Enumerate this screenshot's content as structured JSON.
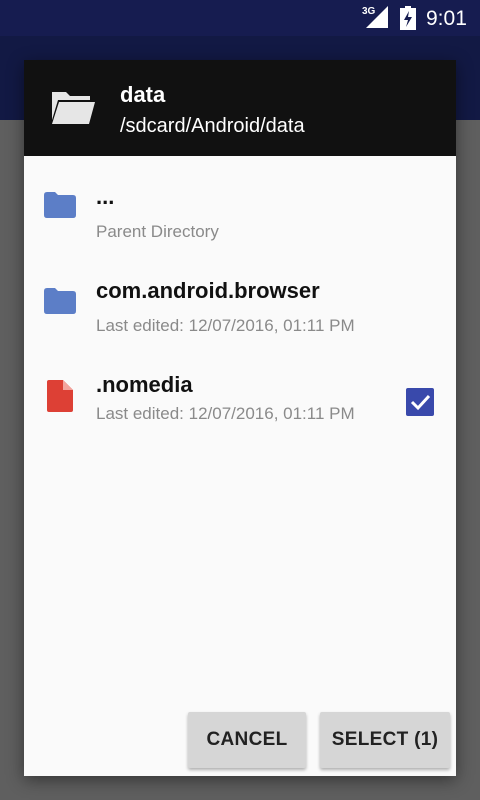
{
  "status_bar": {
    "network_label": "3G",
    "time": "9:01"
  },
  "dialog": {
    "header": {
      "icon": "folder-open-icon",
      "title": "data",
      "path": "/sdcard/Android/data"
    },
    "items": [
      {
        "icon": "folder-icon",
        "name": "...",
        "subtitle": "Parent Directory",
        "checked": false
      },
      {
        "icon": "folder-icon",
        "name": "com.android.browser",
        "subtitle": "Last edited: 12/07/2016, 01:11 PM",
        "checked": false
      },
      {
        "icon": "file-icon",
        "name": ".nomedia",
        "subtitle": "Last edited: 12/07/2016, 01:11 PM",
        "checked": true
      }
    ],
    "buttons": {
      "cancel_label": "CANCEL",
      "select_label": "SELECT (1)"
    }
  },
  "colors": {
    "status_bar": "#161c50",
    "app_bar": "#121944",
    "dialog_header": "#111111",
    "folder_icon": "#5c7ec7",
    "file_icon": "#dd4035",
    "checkbox": "#3949ab",
    "button_bg": "#d6d6d6",
    "scrim": "#5f5f5f"
  }
}
